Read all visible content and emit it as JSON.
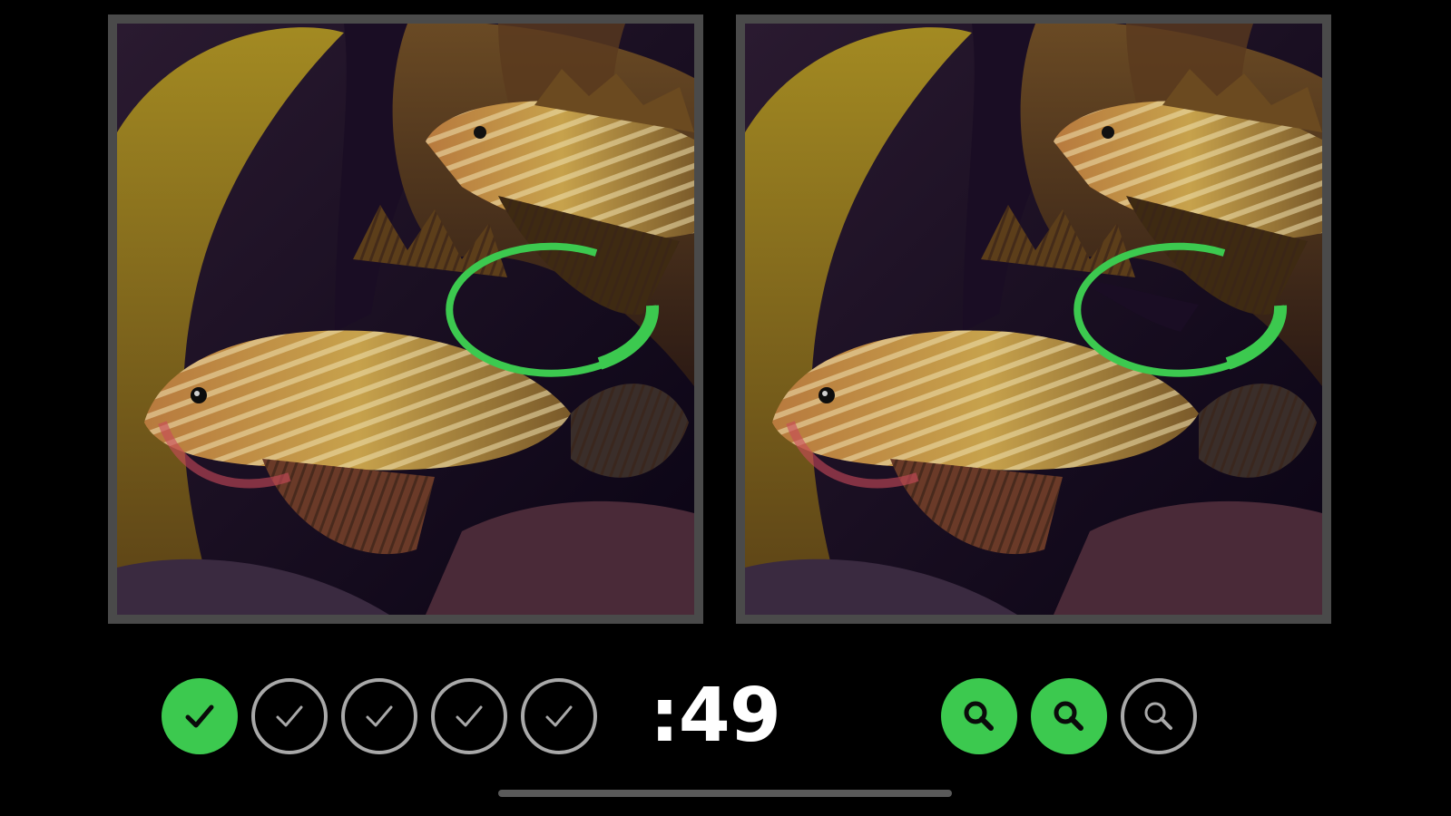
{
  "game": {
    "timer_text": ":49",
    "differences": {
      "total": 5,
      "found": 1,
      "items": [
        {
          "state": "found",
          "icon": "checkmark-icon"
        },
        {
          "state": "remaining",
          "icon": "checkmark-icon"
        },
        {
          "state": "remaining",
          "icon": "checkmark-icon"
        },
        {
          "state": "remaining",
          "icon": "checkmark-icon"
        },
        {
          "state": "remaining",
          "icon": "checkmark-icon"
        }
      ]
    },
    "hints": {
      "total": 3,
      "available": 2,
      "items": [
        {
          "state": "available",
          "icon": "magnifier-icon"
        },
        {
          "state": "available",
          "icon": "magnifier-icon"
        },
        {
          "state": "used",
          "icon": "magnifier-icon"
        }
      ]
    },
    "panels": [
      {
        "id": "original",
        "subject": "lionfish"
      },
      {
        "id": "modified",
        "subject": "lionfish"
      }
    ]
  },
  "colors": {
    "accent_green": "#3cc94f",
    "panel_border": "#4a4a4a",
    "inactive_ring": "#a9a9a9",
    "background": "#000000"
  }
}
